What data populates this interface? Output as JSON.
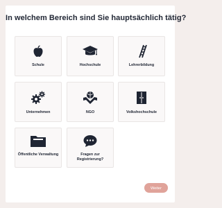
{
  "question": "In welchem Bereich sind Sie hauptsächlich tätig?",
  "options": [
    {
      "label": "Schule",
      "icon": "apple-icon"
    },
    {
      "label": "Hochschule",
      "icon": "graduation-cap-icon"
    },
    {
      "label": "Lehrerbildung",
      "icon": "ladder-icon"
    },
    {
      "label": "Unternehmen",
      "icon": "gears-icon"
    },
    {
      "label": "NGO",
      "icon": "hands-globe-icon"
    },
    {
      "label": "Volkshochschule",
      "icon": "door-icon"
    },
    {
      "label": "Öffentliche Verwaltung",
      "icon": "folder-icon"
    },
    {
      "label": "Fragen zur Registrierung?",
      "icon": "chat-bubble-icon"
    }
  ],
  "next_button": "Weiter",
  "colors": {
    "accent": "#e0a39a",
    "icon": "#1f2533",
    "background": "#f4eeec"
  }
}
